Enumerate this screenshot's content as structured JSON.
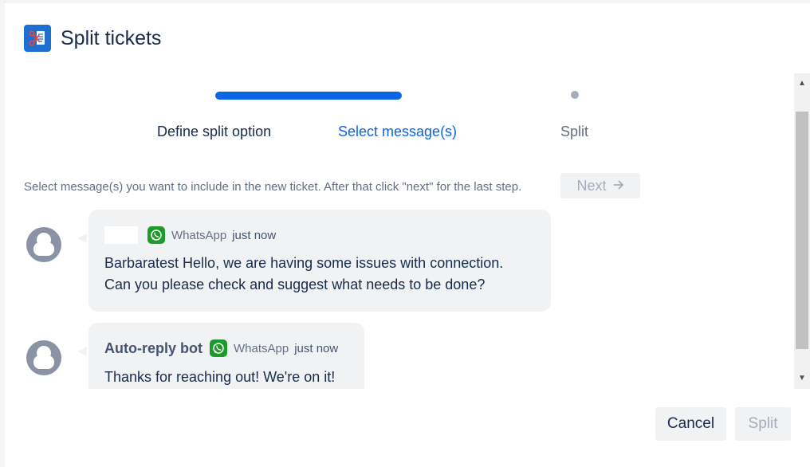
{
  "dialog": {
    "title": "Split tickets",
    "icon": "scissors-document-icon"
  },
  "stepper": {
    "steps": [
      {
        "label": "Define split option",
        "state": "completed"
      },
      {
        "label": "Select message(s)",
        "state": "active"
      },
      {
        "label": "Split",
        "state": "upcoming"
      }
    ]
  },
  "instructions": {
    "text": "Select message(s) you want to include in the new ticket. After that click \"next\" for the last step.",
    "next_label": "Next",
    "next_icon": "arrow-right-icon"
  },
  "messages": [
    {
      "sender": "",
      "channel": "WhatsApp",
      "time": "just now",
      "lines": [
        "Barbaratest Hello, we are having some issues with connection.",
        "Can you please check and suggest what needs to be done?"
      ]
    },
    {
      "sender": "Auto-reply bot",
      "channel": "WhatsApp",
      "time": "just now",
      "lines": [
        "Thanks for reaching out! We're on it!"
      ]
    }
  ],
  "footer": {
    "cancel_label": "Cancel",
    "split_label": "Split"
  },
  "colors": {
    "accent": "#0c66e4",
    "whatsapp": "#1e9a2b",
    "bubble": "#f1f2f4",
    "disabled_text": "#a5adba"
  }
}
